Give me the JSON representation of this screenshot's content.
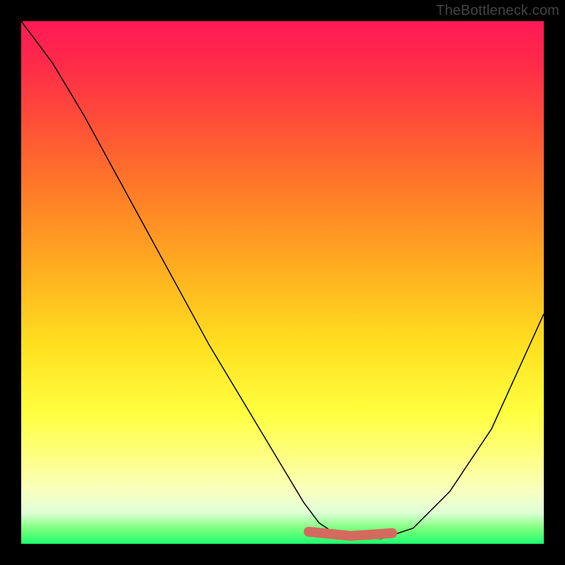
{
  "watermark": "TheBottleneck.com",
  "chart_data": {
    "type": "line",
    "title": "",
    "xlabel": "",
    "ylabel": "",
    "xlim": [
      0,
      100
    ],
    "ylim": [
      0,
      100
    ],
    "series": [
      {
        "name": "curve",
        "x": [
          0,
          6,
          12,
          18,
          24,
          30,
          36,
          42,
          48,
          54,
          57,
          60,
          63,
          69,
          75,
          82,
          90,
          100
        ],
        "y": [
          100,
          92,
          82,
          71,
          60,
          49,
          38,
          28,
          18,
          8,
          4,
          2,
          1,
          1,
          3,
          10,
          22,
          44
        ]
      }
    ],
    "highlight_band": {
      "x_start": 55,
      "x_end": 71,
      "y": 1.5
    },
    "gradient_stops": [
      {
        "pos": 0,
        "color": "#ff1a55"
      },
      {
        "pos": 50,
        "color": "#ffe020"
      },
      {
        "pos": 90,
        "color": "#ffff80"
      },
      {
        "pos": 100,
        "color": "#1eff6e"
      }
    ]
  }
}
